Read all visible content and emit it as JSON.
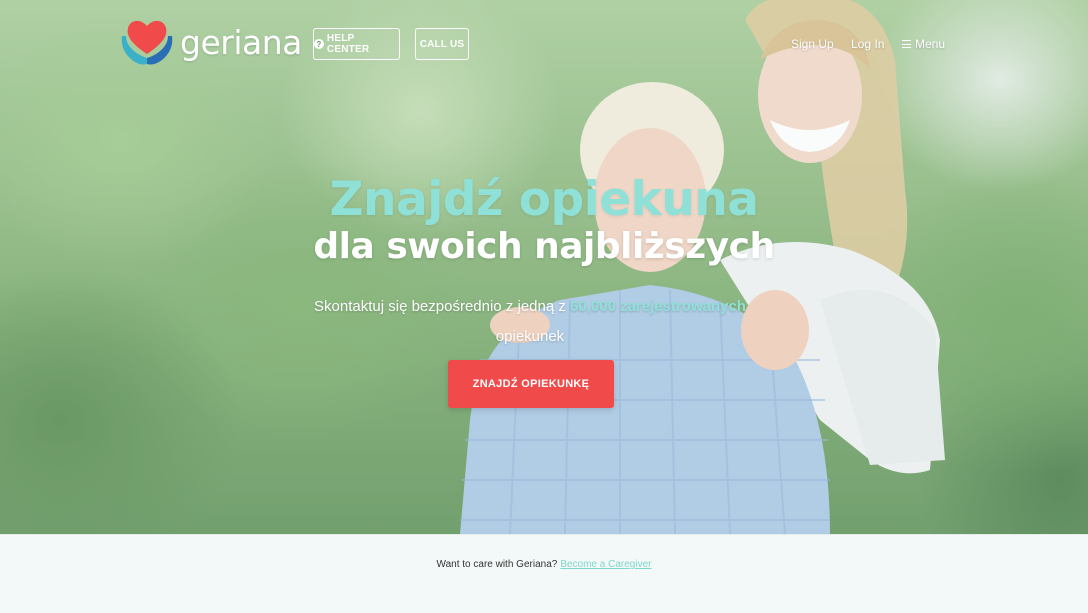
{
  "brand": {
    "name": "geriana"
  },
  "nav": {
    "help_center": "HELP CENTER",
    "call_us": "CALL US",
    "sign_up": "Sign Up",
    "log_in": "Log In",
    "menu": "Menu"
  },
  "hero": {
    "headline": "Znajdź opiekuna",
    "subheadline": "dla swoich najbliższych",
    "description_before": "Skontaktuj się bezpośrednio z jedną z",
    "description_highlight": "60,000 zarejestrowanych",
    "description_after": "opiekunek",
    "cta": "ZNAJDŹ OPIEKUNKĘ"
  },
  "footer_strip": {
    "text": "Want to care with Geriana?",
    "link": "Become a Caregiver"
  },
  "colors": {
    "accent": "#8fe1d8",
    "cta": "#f04a4a",
    "strip_bg": "#f3f9f8",
    "logo_heart": "#f04a4a",
    "logo_hands": "#3bb0c9"
  },
  "icons": [
    "heart-hands-logo-icon",
    "question-circle-icon",
    "hamburger-menu-icon"
  ]
}
